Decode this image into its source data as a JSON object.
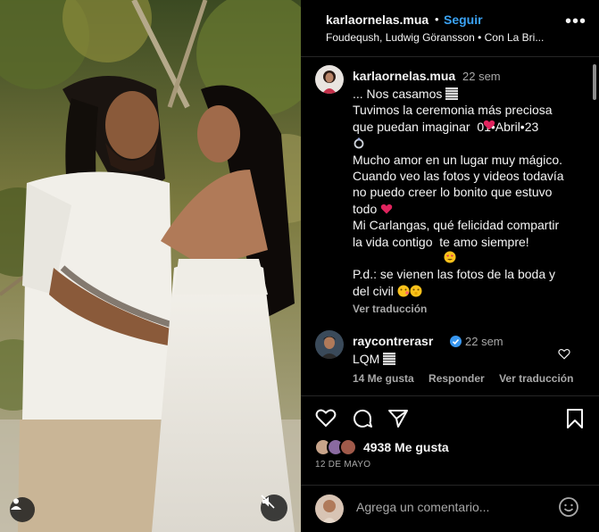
{
  "header": {
    "username": "karlaornelas.mua",
    "separator": "•",
    "follow_label": "Seguir",
    "audio": "Foudeqush, Ludwig Göransson • Con La Bri..."
  },
  "caption": {
    "username": "karlaornelas.mua",
    "time": "22 sem",
    "lines": [
      "... Nos casamos ",
      "Tuvimos la ceremonia más preciosa",
      "que puedan imaginar  01•Abril•23",
      "",
      "Mucho amor en un lugar muy mágico.",
      "Cuando veo las fotos y videos todavía",
      "no puedo creer lo bonito que estuvo",
      "todo ",
      "Mi Carlangas, qué felicidad compartir",
      "la vida contigo  te amo siempre!",
      "",
      "P.d.: se vienen las fotos de la boda y",
      "del civil "
    ],
    "see_translation": "Ver traducción"
  },
  "comment": {
    "username": "raycontrerasr",
    "time": "22 sem",
    "text": "LQM ",
    "likes": "14 Me gusta",
    "reply": "Responder",
    "see_translation": "Ver traducción"
  },
  "actions": {
    "likes_count": "4938 Me gusta",
    "date": "12 DE MAYO"
  },
  "comment_box": {
    "placeholder": "Agrega un comentario..."
  },
  "icons": {
    "heart": "heart-icon",
    "comment": "comment-icon",
    "share": "share-icon",
    "save": "bookmark-icon",
    "emoji": "emoji-icon",
    "more": "more-options-icon",
    "mute": "muted-speaker-icon",
    "tag": "user-tag-icon"
  },
  "colors": {
    "background": "#000000",
    "text": "#f5f5f5",
    "secondary": "#a8a8a8",
    "link": "#3ba3f5",
    "heart_emoji": "#e0245e",
    "divider": "#262626"
  }
}
